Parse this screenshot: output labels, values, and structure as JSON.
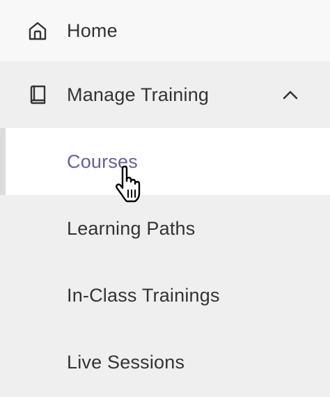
{
  "nav": {
    "home": {
      "label": "Home",
      "icon": "home-icon"
    },
    "manage_training": {
      "label": "Manage Training",
      "icon": "book-icon",
      "expanded": true,
      "toggle_icon": "chevron-up-icon",
      "items": [
        {
          "label": "Courses",
          "active": true
        },
        {
          "label": "Learning Paths",
          "active": false
        },
        {
          "label": "In-Class Trainings",
          "active": false
        },
        {
          "label": "Live Sessions",
          "active": false
        }
      ]
    }
  },
  "colors": {
    "active_text": "#6a5f9a",
    "text": "#333333",
    "submenu_bg": "#efefef",
    "active_bg": "#ffffff"
  }
}
